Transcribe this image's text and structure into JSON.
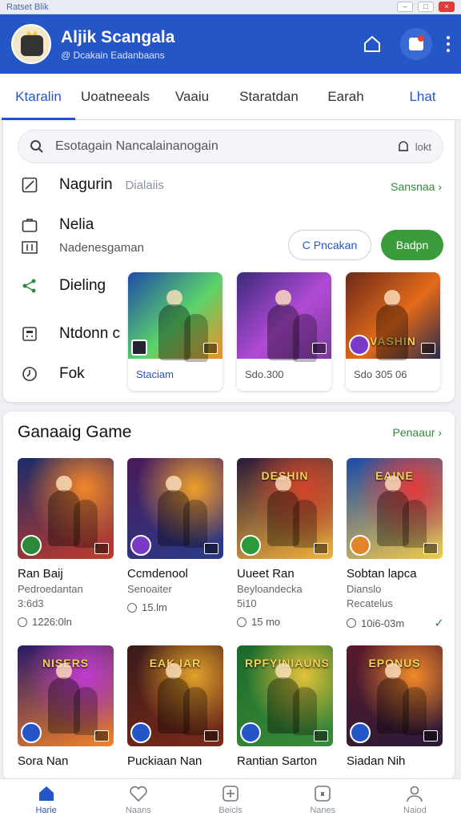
{
  "window": {
    "title": "Ratset Blik",
    "controls": [
      "–",
      "□",
      "×"
    ]
  },
  "header": {
    "name": "Aljik Scangala",
    "subtitle": "@ Dcakain Eadanbaans"
  },
  "tabs": [
    {
      "label": "Ktaralin"
    },
    {
      "label": "Uoatneeals"
    },
    {
      "label": "Vaaiu"
    },
    {
      "label": "Staratdan"
    },
    {
      "label": "Earah"
    },
    {
      "label": "Lhat"
    }
  ],
  "search": {
    "placeholder": "Esotagain Nancalainanogain",
    "right": "lokt"
  },
  "menu": {
    "rows": [
      {
        "label": "Nagurin",
        "sub": "Dialaiis"
      },
      {
        "label": "Nelia"
      },
      {
        "label": "Nadenesgaman"
      },
      {
        "label": "Dieling"
      },
      {
        "label": "Ntdonn c"
      },
      {
        "label": "Fok"
      }
    ],
    "see_all": "Sansnaa"
  },
  "buttons": {
    "outline": "Pncakan",
    "outline_icon": "C",
    "green": "Badpn"
  },
  "featured": [
    {
      "caption": "Staciam",
      "art_label": "",
      "colors": [
        "#1f4aa8",
        "#5bd36a",
        "#f28c28"
      ]
    },
    {
      "caption": "Sdo.300",
      "art_label": "",
      "colors": [
        "#3a2a7a",
        "#b24ad6",
        "#7a3a9a"
      ]
    },
    {
      "caption": "Sdo 305 06",
      "art_label": "VASHIN",
      "colors": [
        "#6a2a1a",
        "#e56a1a",
        "#2a2a4a"
      ]
    }
  ],
  "games_section": {
    "title": "Ganaaig Game",
    "more": "Penaaur"
  },
  "games": [
    {
      "title": "Ran Baij",
      "sub1": "Pedroedantan",
      "sub2": "3:6d3",
      "time": "1226:0ln",
      "art": "",
      "colors": [
        "#1a2b6a",
        "#f2872a",
        "#c23b2a"
      ],
      "badge": "#2a8a3a"
    },
    {
      "title": "Ccmdenool",
      "sub1": "Senoaiter",
      "sub2": "",
      "time": "15.lm",
      "art": "",
      "colors": [
        "#4a1a5a",
        "#f0a02a",
        "#2a3a8a"
      ],
      "badge": "#7a3ac8"
    },
    {
      "title": "Uueet Ran",
      "sub1": "Beyloandecka",
      "sub2": "5i10",
      "time": "15 mo",
      "art": "DESHIN",
      "colors": [
        "#2a1a3a",
        "#d2442a",
        "#f2b23a"
      ],
      "badge": "#2a9a3a"
    },
    {
      "title": "Sobtan lapca",
      "sub1": "Dianslo",
      "sub2": "Recatelus",
      "time": "10i6-03m",
      "art": "EAINE",
      "colors": [
        "#1a4aa8",
        "#e23a3a",
        "#f2c84a"
      ],
      "badge": "#e2842a",
      "check": "✓"
    },
    {
      "title": "Sora Nan",
      "sub1": "",
      "sub2": "",
      "time": "",
      "art": "NISERS",
      "colors": [
        "#2a1a6a",
        "#c03ad0",
        "#f2842a"
      ],
      "badge": "#2456c8"
    },
    {
      "title": "Puckiaan Nan",
      "sub1": "",
      "sub2": "",
      "time": "",
      "art": "EAK IAR",
      "colors": [
        "#3a1a1a",
        "#e2a22a",
        "#7a2a1a"
      ],
      "badge": "#2456c8"
    },
    {
      "title": "Rantian Sarton",
      "sub1": "",
      "sub2": "",
      "time": "",
      "art": "RPFYINIAUNS",
      "colors": [
        "#1a6a2a",
        "#e2c23a",
        "#3a8a3a"
      ],
      "badge": "#2456c8"
    },
    {
      "title": "Siadan Nih",
      "sub1": "",
      "sub2": "",
      "time": "",
      "art": "EPONUS",
      "colors": [
        "#5a1a2a",
        "#f28a2a",
        "#2a1a3a"
      ],
      "badge": "#2456c8"
    }
  ],
  "bottom_nav": [
    {
      "label": "Harie",
      "icon": "home-icon"
    },
    {
      "label": "Naans",
      "icon": "heart-icon"
    },
    {
      "label": "Beicls",
      "icon": "plus-square-icon"
    },
    {
      "label": "Nanes",
      "icon": "tablet-icon"
    },
    {
      "label": "Naiod",
      "icon": "profile-icon"
    }
  ],
  "colors": {
    "primary": "#2456c8",
    "accent_green": "#3a9b3a",
    "link_green": "#2f8a3a"
  }
}
